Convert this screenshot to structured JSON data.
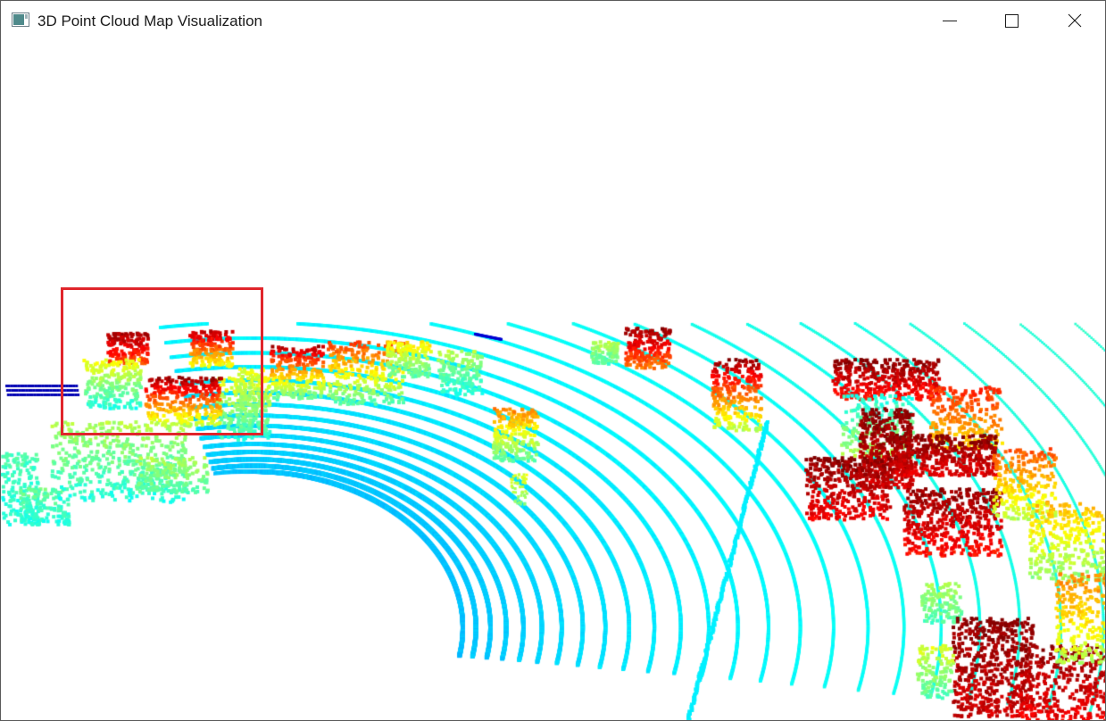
{
  "window": {
    "title": "3D Point Cloud Map Visualization",
    "icon": "app-window-icon",
    "controls": {
      "minimize_icon": "minimize-icon",
      "maximize_icon": "maximize-icon",
      "close_icon": "close-icon"
    }
  },
  "viewport": {
    "background": "#ffffff",
    "colormap": "jet",
    "colormap_stops": [
      "#00008f",
      "#0050ff",
      "#00c8ff",
      "#60ffa0",
      "#ffff00",
      "#ff8000",
      "#e00000",
      "#800000"
    ],
    "selection_box_color": "#e0252b"
  }
}
